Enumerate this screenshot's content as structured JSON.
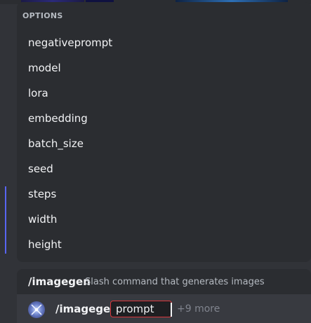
{
  "options": {
    "header": "OPTIONS",
    "items": [
      {
        "label": "negativeprompt"
      },
      {
        "label": "model"
      },
      {
        "label": "lora"
      },
      {
        "label": "embedding"
      },
      {
        "label": "batch_size"
      },
      {
        "label": "seed"
      },
      {
        "label": "steps"
      },
      {
        "label": "width"
      },
      {
        "label": "height"
      }
    ]
  },
  "command": {
    "name": "/imagegen",
    "description": "Slash command that generates images"
  },
  "input": {
    "command": "/imagegen",
    "active_param": "prompt",
    "more_label": "+9 more",
    "bot_icon": "bot-avatar-icon"
  },
  "colors": {
    "accent": "#5865f2",
    "error": "#da373c",
    "background": "#313338"
  }
}
